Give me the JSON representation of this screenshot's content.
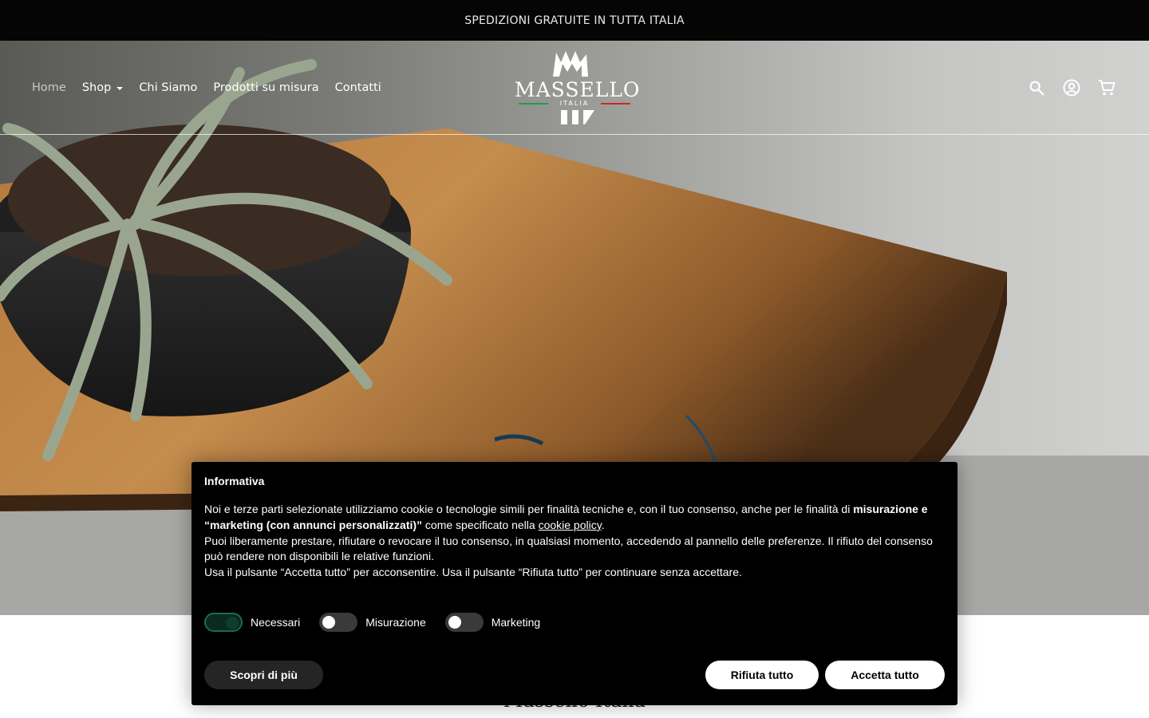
{
  "announcement": "SPEDIZIONI GRATUITE IN TUTTA ITALIA",
  "nav": {
    "home": "Home",
    "shop": "Shop",
    "chi_siamo": "Chi Siamo",
    "prodotti": "Prodotti su misura",
    "contatti": "Contatti"
  },
  "logo": {
    "name": "MASSELLO",
    "sub": "ITALIA"
  },
  "header_icons": [
    "search-icon",
    "account-icon",
    "cart-icon"
  ],
  "below_title": "Massello Italia",
  "cookie": {
    "title": "Informativa",
    "p1_a": "Noi e terze parti selezionate utilizziamo cookie o tecnologie simili per finalità tecniche e, con il tuo consenso, anche per le finalità di ",
    "p1_bold": "misurazione e “marketing (con annunci personalizzati)”",
    "p1_b": " come specificato nella ",
    "p1_link": "cookie policy",
    "p1_c": ".",
    "p2": "Puoi liberamente prestare, rifiutare o revocare il tuo consenso, in qualsiasi momento, accedendo al pannello delle preferenze. Il rifiuto del consenso può rendere non disponibili le relative funzioni.",
    "p3": "Usa il pulsante “Accetta tutto” per acconsentire. Usa il pulsante “Rifiuta tutto” per continuare senza accettare.",
    "toggles": [
      {
        "label": "Necessari",
        "on": true
      },
      {
        "label": "Misurazione",
        "on": false
      },
      {
        "label": "Marketing",
        "on": false
      }
    ],
    "btn_more": "Scopri di più",
    "btn_reject": "Rifiuta tutto",
    "btn_accept": "Accetta tutto"
  },
  "colors": {
    "accent_green": "#1c6b52",
    "flag_green": "#1e9e4a",
    "flag_red": "#d2232a"
  }
}
